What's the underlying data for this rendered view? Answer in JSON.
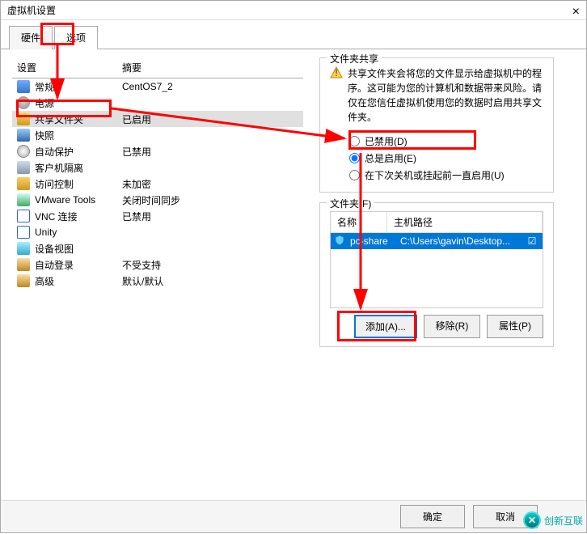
{
  "window": {
    "title": "虚拟机设置"
  },
  "tabs": {
    "hardware": "硬件",
    "options": "选项"
  },
  "left": {
    "header_setting": "设置",
    "header_summary": "摘要",
    "items": [
      {
        "name": "常规",
        "summary": "CentOS7_2",
        "icon": "ico-general"
      },
      {
        "name": "电源",
        "summary": "",
        "icon": "ico-power"
      },
      {
        "name": "共享文件夹",
        "summary": "已启用",
        "icon": "ico-folder",
        "selected": true
      },
      {
        "name": "快照",
        "summary": "",
        "icon": "ico-snap"
      },
      {
        "name": "自动保护",
        "summary": "已禁用",
        "icon": "ico-clock"
      },
      {
        "name": "客户机隔离",
        "summary": "",
        "icon": "ico-iso"
      },
      {
        "name": "访问控制",
        "summary": "未加密",
        "icon": "ico-key"
      },
      {
        "name": "VMware Tools",
        "summary": "关闭时间同步",
        "icon": "ico-vm"
      },
      {
        "name": "VNC 连接",
        "summary": "已禁用",
        "icon": "ico-vnc"
      },
      {
        "name": "Unity",
        "summary": "",
        "icon": "ico-unity"
      },
      {
        "name": "设备视图",
        "summary": "",
        "icon": "ico-dev"
      },
      {
        "name": "自动登录",
        "summary": "不受支持",
        "icon": "ico-auto"
      },
      {
        "name": "高级",
        "summary": "默认/默认",
        "icon": "ico-adv"
      }
    ]
  },
  "right": {
    "share_title": "文件夹共享",
    "warning": "共享文件夹会将您的文件显示给虚拟机中的程序。这可能为您的计算机和数据带来风险。请仅在您信任虚拟机使用您的数据时启用共享文件夹。",
    "radio_disabled": "已禁用(D)",
    "radio_always": "总是启用(E)",
    "radio_until": "在下次关机或挂起前一直启用(U)",
    "folders_title": "文件夹(F)",
    "folders_header_name": "名称",
    "folders_header_path": "主机路径",
    "folder_row": {
      "name": "pc-share",
      "path": "C:\\Users\\gavin\\Desktop...",
      "checked": "☑"
    },
    "btn_add": "添加(A)...",
    "btn_remove": "移除(R)",
    "btn_props": "属性(P)"
  },
  "footer": {
    "ok": "确定",
    "cancel": "取消"
  },
  "watermark": "创新互联"
}
